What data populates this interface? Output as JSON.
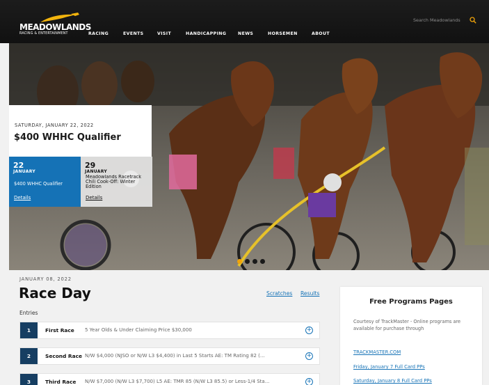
{
  "header": {
    "logo": {
      "wordmark": "MEADOWLANDS",
      "tagline": "RACING & ENTERTAINMENT"
    },
    "nav": [
      "RACING",
      "EVENTS",
      "VISIT",
      "HANDICAPPING",
      "NEWS",
      "HORSEMEN",
      "ABOUT"
    ],
    "search": {
      "placeholder": "Search Meadowlands",
      "icon": "search-icon"
    }
  },
  "hero": {
    "featured": {
      "date": "SATURDAY, JANUARY 22, 2022",
      "title": "$400 WHHC Qualifier"
    },
    "events": [
      {
        "day": "22",
        "month": "JANUARY",
        "name": "$400 WHHC Qualifier",
        "link": "Details"
      },
      {
        "day": "29",
        "month": "JANUARY",
        "name": "Meadowlands Racetrack Chili Cook-Off: Winter Edition",
        "link": "Details"
      }
    ],
    "carousel": {
      "count": 4,
      "active_index": 0
    },
    "colors": {
      "accent": "#1572b6",
      "dot_active": "#f0a30a"
    }
  },
  "main": {
    "date": "JANUARY 08, 2022",
    "title": "Race Day",
    "links": [
      "Scratches",
      "Results"
    ],
    "entries_label": "Entries",
    "races": [
      {
        "num": "1",
        "name": "First Race",
        "conditions": "5 Year Olds & Under Claiming Price $30,000"
      },
      {
        "num": "2",
        "name": "Second Race",
        "conditions": "N/W $4,000 (NJSO or N/W L3 $4,400) in Last 5 Starts AE: TM Rating 82 (..."
      },
      {
        "num": "3",
        "name": "Third Race",
        "conditions": "N/W $7,000 (N/W L3 $7,700) L5 AE: TMR 85 (N/W L3 85.5) or Less-1/4 Sta..."
      }
    ]
  },
  "sidebar": {
    "title": "Free Programs Pages",
    "text": "Courtesy of TrackMaster - Online programs are available for purchase through",
    "links": [
      "TRACKMASTER.COM",
      "Friday, January 7 Full Card PPs",
      "Saturday, January 8 Full Card PPs"
    ]
  }
}
